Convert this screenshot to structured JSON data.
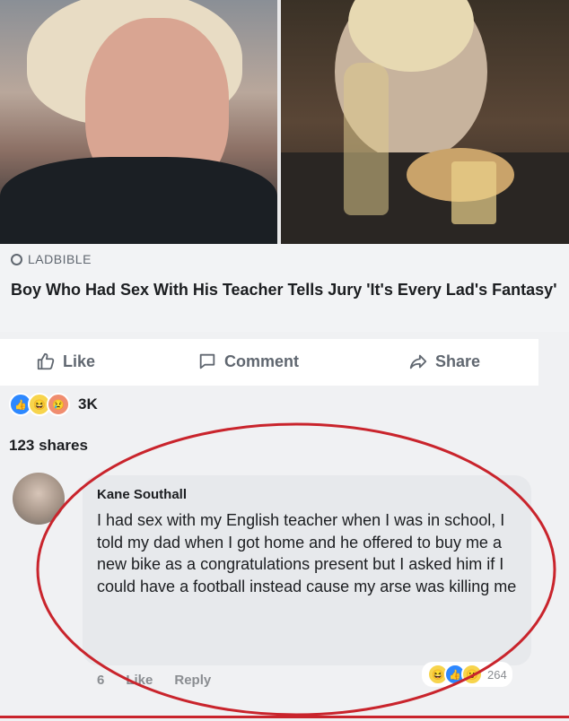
{
  "post": {
    "source": "LADBIBLE",
    "headline": "Boy Who Had Sex With His Teacher Tells Jury 'It's Every Lad's Fantasy'"
  },
  "actions": {
    "like": "Like",
    "comment": "Comment",
    "share": "Share"
  },
  "reactions": {
    "count": "3K"
  },
  "shares": "123 shares",
  "comment": {
    "author": "Kane Southall",
    "text": "I had sex with my English teacher when I was in school, I told my dad when I got home and he offered to buy me a new bike as a congratulations present but I asked him if I could have a football instead cause my arse was killing me",
    "time": "6",
    "like": "Like",
    "reply": "Reply",
    "reaction_count": "264"
  },
  "colors": {
    "highlight": "#c9242c",
    "like_blue": "#2d88ff"
  }
}
